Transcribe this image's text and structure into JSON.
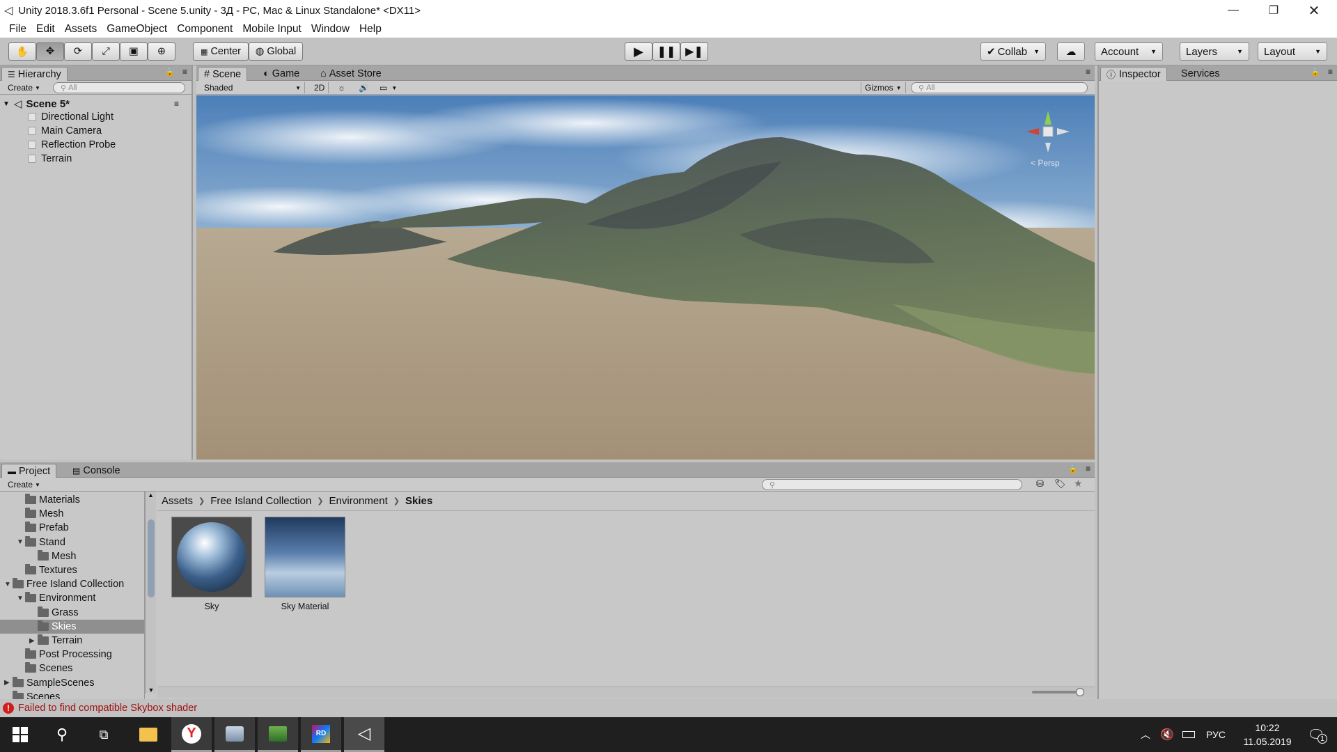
{
  "window": {
    "title": "Unity 2018.3.6f1 Personal - Scene 5.unity - 3Д - PC, Mac & Linux Standalone* <DX11>"
  },
  "menu": [
    "File",
    "Edit",
    "Assets",
    "GameObject",
    "Component",
    "Mobile Input",
    "Window",
    "Help"
  ],
  "toolbar": {
    "center": "Center",
    "global": "Global",
    "collab": "Collab",
    "account": "Account",
    "layers": "Layers",
    "layout": "Layout"
  },
  "hierarchy": {
    "tab": "Hierarchy",
    "create": "Create",
    "search_placeholder": "All",
    "scene": "Scene 5*",
    "items": [
      "Directional Light",
      "Main Camera",
      "Reflection Probe",
      "Terrain"
    ]
  },
  "scene": {
    "tabs": [
      "Scene",
      "Game",
      "Asset Store"
    ],
    "shading": "Shaded",
    "mode_2d": "2D",
    "gizmos": "Gizmos",
    "search_placeholder": "All",
    "gizmo_label": "< Persp"
  },
  "inspector": {
    "tabs": [
      "Inspector",
      "Services"
    ]
  },
  "project": {
    "tabs": [
      "Project",
      "Console"
    ],
    "create": "Create",
    "tree": [
      {
        "label": "Materials",
        "depth": 2,
        "arrow": ""
      },
      {
        "label": "Mesh",
        "depth": 2,
        "arrow": ""
      },
      {
        "label": "Prefab",
        "depth": 2,
        "arrow": ""
      },
      {
        "label": "Stand",
        "depth": 2,
        "arrow": "▼"
      },
      {
        "label": "Mesh",
        "depth": 3,
        "arrow": ""
      },
      {
        "label": "Textures",
        "depth": 2,
        "arrow": ""
      },
      {
        "label": "Free Island Collection",
        "depth": 1,
        "arrow": "▼"
      },
      {
        "label": "Environment",
        "depth": 2,
        "arrow": "▼"
      },
      {
        "label": "Grass",
        "depth": 3,
        "arrow": ""
      },
      {
        "label": "Skies",
        "depth": 3,
        "arrow": "",
        "selected": true
      },
      {
        "label": "Terrain",
        "depth": 3,
        "arrow": "▶"
      },
      {
        "label": "Post Processing",
        "depth": 2,
        "arrow": ""
      },
      {
        "label": "Scenes",
        "depth": 2,
        "arrow": ""
      },
      {
        "label": "SampleScenes",
        "depth": 1,
        "arrow": "▶"
      },
      {
        "label": "Scenes",
        "depth": 1,
        "arrow": ""
      }
    ],
    "breadcrumb": [
      "Assets",
      "Free Island Collection",
      "Environment",
      "Skies"
    ],
    "assets": [
      "Sky",
      "Sky Material"
    ]
  },
  "status": {
    "message": "Failed to find compatible Skybox shader"
  },
  "taskbar": {
    "lang": "РУС",
    "time": "10:22",
    "date": "11.05.2019",
    "notifications": "1"
  }
}
